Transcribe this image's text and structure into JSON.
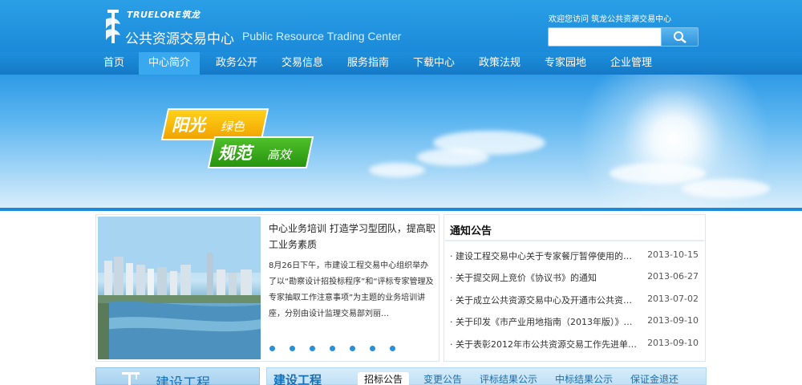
{
  "header": {
    "brand": "TRUELORE筑龙",
    "title_cn": "公共资源交易中心",
    "title_en": "Public Resource Trading Center",
    "welcome": "欢迎您访问 筑龙公共资源交易中心",
    "search": {
      "value": "",
      "button_icon": "search-icon"
    }
  },
  "nav": {
    "items": [
      {
        "label": "首页"
      },
      {
        "label": "中心简介",
        "active": true
      },
      {
        "label": "政务公开"
      },
      {
        "label": "交易信息"
      },
      {
        "label": "服务指南"
      },
      {
        "label": "下载中心"
      },
      {
        "label": "政策法规"
      },
      {
        "label": "专家园地"
      },
      {
        "label": "企业管理"
      }
    ]
  },
  "banner": {
    "slogan1_main": "阳光",
    "slogan1_sub": "绿色",
    "slogan2_main": "规范",
    "slogan2_sub": "高效"
  },
  "news": {
    "title": "中心业务培训 打造学习型团队，提高职工业务素质",
    "body": "8月26日下午，市建设工程交易中心组织举办了以“勘察设计招投标程序”和“评标专家管理及专家抽取工作注意事项”为主题的业务培训讲座，分别由设计监理交易部刘丽…",
    "dot_count": 7
  },
  "notice": {
    "title": "通知公告",
    "items": [
      {
        "text": "建设工程交易中心关于专家餐厅暂停使用的…",
        "date": "2013-10-15"
      },
      {
        "text": "关于提交网上竞价《协议书》的通知",
        "date": "2013-06-27"
      },
      {
        "text": "关于成立公共资源交易中心及开通市公共资…",
        "date": "2013-07-02"
      },
      {
        "text": "关于印发《市产业用地指南（2013年版）》…",
        "date": "2013-09-10"
      },
      {
        "text": "关于表彰2012年市公共资源交易工作先进单…",
        "date": "2013-09-10"
      }
    ]
  },
  "bottom": {
    "left_title": "建设工程",
    "section_title": "建设工程",
    "tabs": [
      {
        "label": "招标公告",
        "active": true
      },
      {
        "label": "变更公告"
      },
      {
        "label": "评标结果公示"
      },
      {
        "label": "中标结果公示"
      },
      {
        "label": "保证金退还"
      }
    ]
  },
  "colors": {
    "header_blue": "#1b8ad9",
    "nav_active": "#3aa8ee",
    "link_blue": "#1670b8",
    "slogan_yellow": "#f1a300",
    "slogan_green": "#27940f"
  }
}
